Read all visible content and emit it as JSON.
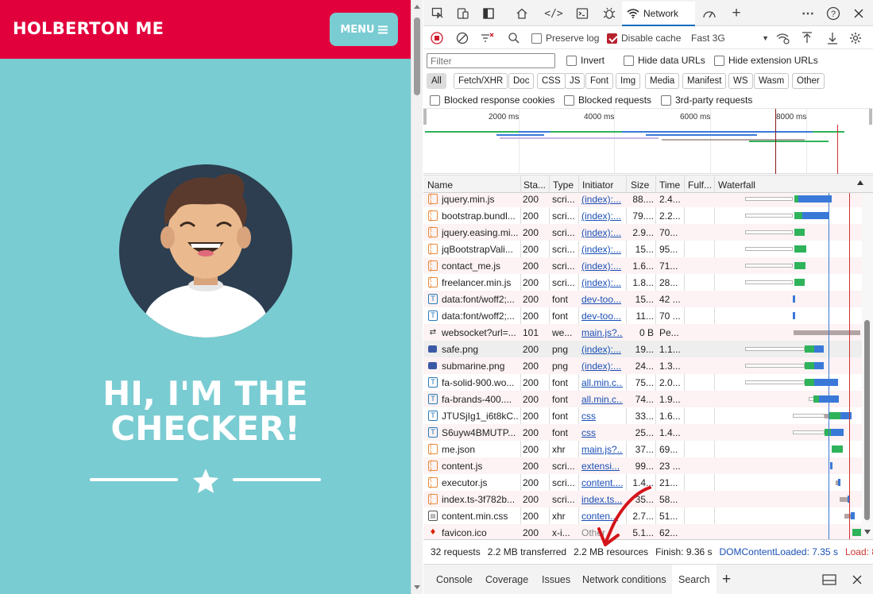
{
  "page": {
    "brand": "HOLBERTON ME",
    "menu_label": "MENU",
    "hero_line1": "HI, I'M THE",
    "hero_line2": "CHECKER!"
  },
  "devtools": {
    "active_tab": "Network",
    "toolbar": {
      "preserve_log": "Preserve log",
      "preserve_log_checked": false,
      "disable_cache": "Disable cache",
      "disable_cache_checked": true,
      "throttling": "Fast 3G"
    },
    "filter": {
      "placeholder": "Filter",
      "invert": "Invert",
      "hide_data_urls": "Hide data URLs",
      "hide_extension_urls": "Hide extension URLs"
    },
    "type_filters": [
      "All",
      "Fetch/XHR",
      "Doc",
      "CSS",
      "JS",
      "Font",
      "Img",
      "Media",
      "Manifest",
      "WS",
      "Wasm",
      "Other"
    ],
    "active_type_filter": "All",
    "blocking": {
      "blocked_cookies": "Blocked response cookies",
      "blocked_requests": "Blocked requests",
      "third_party": "3rd-party requests"
    },
    "overview_ticks": [
      "2000 ms",
      "4000 ms",
      "6000 ms",
      "8000 ms"
    ],
    "columns": [
      "Name",
      "Sta...",
      "Type",
      "Initiator",
      "Size",
      "Time",
      "Fulf...",
      "Waterfall"
    ],
    "requests": [
      {
        "name": "jquery.min.js",
        "status": "200",
        "type": "scri...",
        "initiator": "(index):...",
        "size": "88....",
        "time": "2.4...",
        "icon": "js"
      },
      {
        "name": "bootstrap.bundl...",
        "status": "200",
        "type": "scri...",
        "initiator": "(index):...",
        "size": "79....",
        "time": "2.2...",
        "icon": "js"
      },
      {
        "name": "jquery.easing.mi...",
        "status": "200",
        "type": "scri...",
        "initiator": "(index):...",
        "size": "2.9...",
        "time": "70...",
        "icon": "js"
      },
      {
        "name": "jqBootstrapVali...",
        "status": "200",
        "type": "scri...",
        "initiator": "(index):...",
        "size": "15...",
        "time": "95...",
        "icon": "js"
      },
      {
        "name": "contact_me.js",
        "status": "200",
        "type": "scri...",
        "initiator": "(index):...",
        "size": "1.6...",
        "time": "71...",
        "icon": "js"
      },
      {
        "name": "freelancer.min.js",
        "status": "200",
        "type": "scri...",
        "initiator": "(index):...",
        "size": "1.8...",
        "time": "28...",
        "icon": "js"
      },
      {
        "name": "data:font/woff2;...",
        "status": "200",
        "type": "font",
        "initiator": "dev-too...",
        "size": "15...",
        "time": "42 ...",
        "icon": "font"
      },
      {
        "name": "data:font/woff2;...",
        "status": "200",
        "type": "font",
        "initiator": "dev-too...",
        "size": "11...",
        "time": "70 ...",
        "icon": "font"
      },
      {
        "name": "websocket?url=...",
        "status": "101",
        "type": "we...",
        "initiator": "main.js?...",
        "size": "0 B",
        "time": "Pe...",
        "icon": "ws"
      },
      {
        "name": "safe.png",
        "status": "200",
        "type": "png",
        "initiator": "(index):...",
        "size": "19...",
        "time": "1.1...",
        "icon": "img"
      },
      {
        "name": "submarine.png",
        "status": "200",
        "type": "png",
        "initiator": "(index):...",
        "size": "24...",
        "time": "1.3...",
        "icon": "img"
      },
      {
        "name": "fa-solid-900.wo...",
        "status": "200",
        "type": "font",
        "initiator": "all.min.c...",
        "size": "75...",
        "time": "2.0...",
        "icon": "font"
      },
      {
        "name": "fa-brands-400....",
        "status": "200",
        "type": "font",
        "initiator": "all.min.c...",
        "size": "74...",
        "time": "1.9...",
        "icon": "font"
      },
      {
        "name": "JTUSjIg1_i6t8kC...",
        "status": "200",
        "type": "font",
        "initiator": "css",
        "size": "33...",
        "time": "1.6...",
        "icon": "font"
      },
      {
        "name": "S6uyw4BMUTP...",
        "status": "200",
        "type": "font",
        "initiator": "css",
        "size": "25...",
        "time": "1.4...",
        "icon": "font"
      },
      {
        "name": "me.json",
        "status": "200",
        "type": "xhr",
        "initiator": "main.js?...",
        "size": "37...",
        "time": "69...",
        "icon": "js"
      },
      {
        "name": "content.js",
        "status": "200",
        "type": "scri...",
        "initiator": "extensi...",
        "size": "99...",
        "time": "23 ...",
        "icon": "js"
      },
      {
        "name": "executor.js",
        "status": "200",
        "type": "scri...",
        "initiator": "content....",
        "size": "1.4...",
        "time": "21...",
        "icon": "js"
      },
      {
        "name": "index.ts-3f782b...",
        "status": "200",
        "type": "scri...",
        "initiator": "index.ts...",
        "size": "35...",
        "time": "58...",
        "icon": "js"
      },
      {
        "name": "content.min.css",
        "status": "200",
        "type": "xhr",
        "initiator": "conten...",
        "size": "2.7...",
        "time": "51...",
        "icon": "css"
      },
      {
        "name": "favicon.ico",
        "status": "200",
        "type": "x-i...",
        "initiator": "Other",
        "size": "5.1...",
        "time": "62...",
        "icon": "fav"
      }
    ],
    "summary": {
      "requests": "32 requests",
      "transferred": "2.2 MB transferred",
      "resources": "2.2 MB resources",
      "finish": "Finish: 9.36 s",
      "dom_content_loaded": "DOMContentLoaded: 7.35 s",
      "load": "Load: 8.68 s"
    },
    "drawer_tabs": [
      "Console",
      "Coverage",
      "Issues",
      "Network conditions",
      "Search"
    ],
    "active_drawer_tab": "Search"
  }
}
